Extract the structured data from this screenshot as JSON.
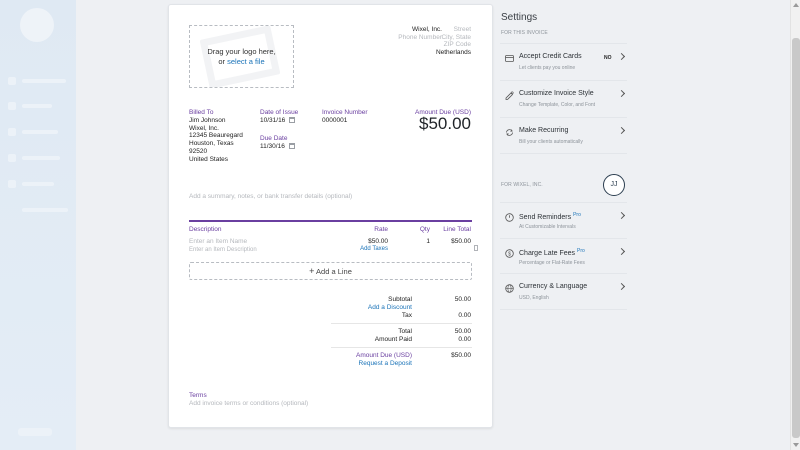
{
  "invoice": {
    "logo_drop": {
      "line1": "Drag your logo here,",
      "line2_prefix": "or ",
      "line2_link": "select a file"
    },
    "company": {
      "name": "Wixel, Inc.",
      "phone_placeholder": "Phone Number",
      "street_placeholder": "Street",
      "city_placeholder": "City, State",
      "zip_placeholder": "ZIP Code",
      "country": "Netherlands"
    },
    "billed_to": {
      "label": "Billed To",
      "lines": [
        "Jim Johnson",
        "Wixel, Inc.",
        "12345 Beauregard",
        "Houston,  Texas",
        "92520",
        "United States"
      ]
    },
    "date_of_issue": {
      "label": "Date of Issue",
      "value": "10/31/16"
    },
    "due_date": {
      "label": "Due Date",
      "value": "11/30/16"
    },
    "invoice_number": {
      "label": "Invoice Number",
      "value": "0000001"
    },
    "amount_due": {
      "label": "Amount Due (USD)",
      "value": "$50.00"
    },
    "summary_placeholder": "Add a summary, notes, or bank transfer details (optional)",
    "table": {
      "headers": {
        "description": "Description",
        "rate": "Rate",
        "qty": "Qty",
        "line_total": "Line Total"
      },
      "row": {
        "name_placeholder": "Enter an Item Name",
        "desc_placeholder": "Enter an Item Description",
        "rate": "$50.00",
        "add_taxes": "Add Taxes",
        "qty": "1",
        "line_total": "$50.00"
      },
      "add_line": "Add a Line"
    },
    "totals": {
      "subtotal_label": "Subtotal",
      "subtotal": "50.00",
      "add_discount": "Add a Discount",
      "tax_label": "Tax",
      "tax": "0.00",
      "total_label": "Total",
      "total": "50.00",
      "amount_paid_label": "Amount Paid",
      "amount_paid": "0.00",
      "amount_due_label": "Amount Due (USD)",
      "amount_due": "$50.00",
      "request_deposit": "Request a Deposit"
    },
    "terms": {
      "label": "Terms",
      "placeholder": "Add invoice terms or conditions (optional)"
    }
  },
  "settings": {
    "title": "Settings",
    "section_this_invoice": "FOR THIS INVOICE",
    "section_company": "FOR WIXEL, INC.",
    "avatar_initials": "JJ",
    "items": [
      {
        "title": "Accept Credit Cards",
        "sub": "Let clients pay you online",
        "badge": "NO",
        "icon": "credit-card-icon"
      },
      {
        "title": "Customize Invoice Style",
        "sub": "Change Template, Color, and Font",
        "icon": "palette-icon"
      },
      {
        "title": "Make Recurring",
        "sub": "Bill your clients automatically",
        "icon": "recurring-icon"
      },
      {
        "title": "Send Reminders",
        "pro": "Pro",
        "sub": "At Customizable Intervals",
        "icon": "clock-icon"
      },
      {
        "title": "Charge Late Fees",
        "pro": "Pro",
        "sub": "Percentage or Flat-Rate Fees",
        "icon": "dollar-icon"
      },
      {
        "title": "Currency & Language",
        "sub": "USD, English",
        "icon": "globe-icon"
      }
    ]
  },
  "colors": {
    "accent_purple": "#6a3fa0",
    "link_blue": "#1a73b8"
  }
}
